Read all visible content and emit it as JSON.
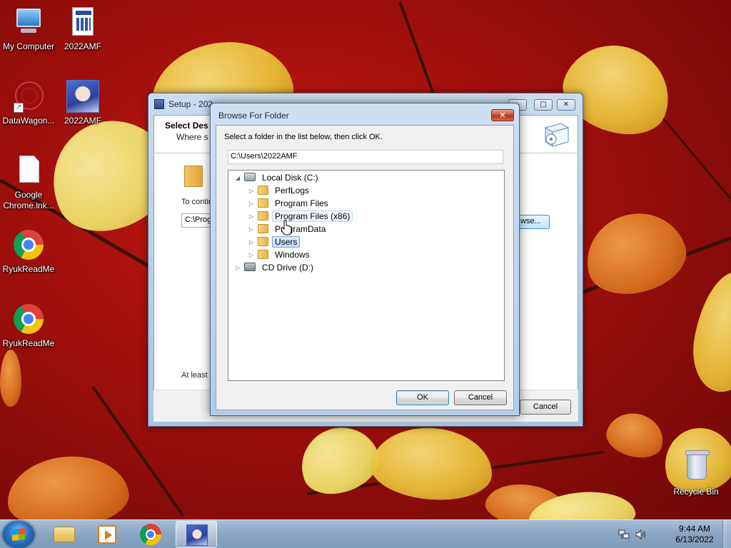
{
  "desktop": {
    "icons": [
      {
        "label": "My Computer"
      },
      {
        "label": "2022AMF"
      },
      {
        "label": "DataWagon..."
      },
      {
        "label": "2022AMF"
      },
      {
        "label": "Google Chrome.lnk..."
      },
      {
        "label": "RyukReadMe"
      },
      {
        "label": "RyukReadMe"
      },
      {
        "label": "Recycle Bin"
      }
    ]
  },
  "setup_window": {
    "title": "Setup - 202",
    "header_title": "Select Des",
    "header_subtitle": "Where s",
    "continue_text": "To contin",
    "path_value": "C:\\Prog",
    "browse_label": "wse...",
    "disk_space_text": "At least",
    "cancel_label": "Cancel"
  },
  "browse_dialog": {
    "title": "Browse For Folder",
    "close_label": "✕",
    "instruction": "Select a folder in the list below, then click OK.",
    "path": "C:\\Users\\2022AMF",
    "tree": [
      {
        "label": "Local Disk (C:)",
        "expander": "◢",
        "icon": "drive-icon"
      },
      {
        "label": "PerfLogs",
        "expander": "▷",
        "icon": "folder-icon"
      },
      {
        "label": "Program Files",
        "expander": "▷",
        "icon": "folder-icon"
      },
      {
        "label": "Program Files (x86)",
        "expander": "▷",
        "icon": "folder-icon"
      },
      {
        "label": "ProgramData",
        "expander": "▷",
        "icon": "folder-icon"
      },
      {
        "label": "Users",
        "expander": "▷",
        "icon": "folder-icon"
      },
      {
        "label": "Windows",
        "expander": "▷",
        "icon": "folder-icon"
      },
      {
        "label": "CD Drive (D:)",
        "expander": "▷",
        "icon": "cd-drive-icon"
      }
    ],
    "selected_item": "Users",
    "hovered_item": "Program Files (x86)",
    "ok_label": "OK",
    "cancel_label": "Cancel"
  },
  "taskbar": {
    "time": "9:44 AM",
    "date": "6/13/2022",
    "pinned": [
      {
        "icon": "file-explorer-icon"
      },
      {
        "icon": "media-player-icon"
      },
      {
        "icon": "chrome-icon"
      },
      {
        "icon": "2022amf-setup-icon"
      }
    ]
  },
  "colors": {
    "wallpaper": "#b3140f",
    "dialog_frame": "#b4cce8",
    "selection": "#c1dbfc",
    "close_button": "#c94b32"
  }
}
